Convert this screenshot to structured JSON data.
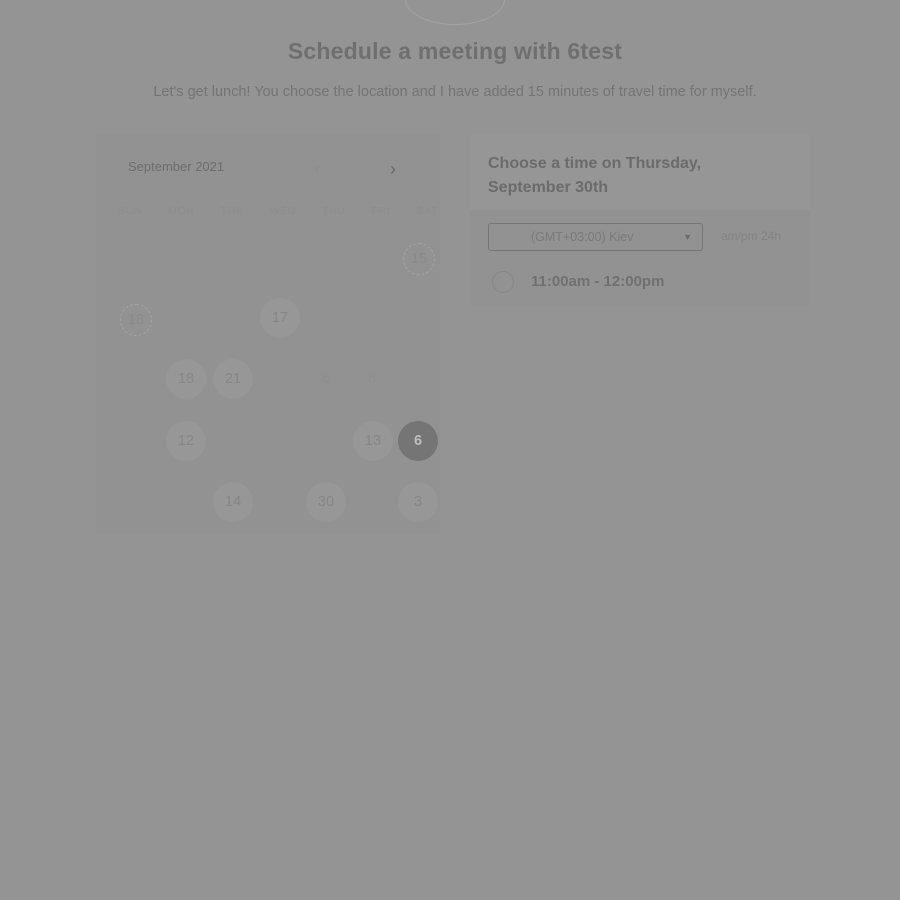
{
  "header": {
    "title": "Schedule a meeting with 6test",
    "subtitle": "Let's get lunch! You choose the location and I have added 15 minutes of travel time for myself."
  },
  "calendar": {
    "month_label": "September 2021",
    "prev_icon": "chevron-left-icon",
    "next_icon": "chevron-right-icon",
    "weekdays": [
      "SUN",
      "MON",
      "TUE",
      "WED",
      "THU",
      "FRI",
      "SAT"
    ],
    "days": [
      {
        "label": "15",
        "style": "dashed"
      },
      {
        "label": "18",
        "style": "dashed"
      },
      {
        "label": "17",
        "style": "available"
      },
      {
        "label": "18",
        "style": "available"
      },
      {
        "label": "21",
        "style": "available"
      },
      {
        "label": "6",
        "style": "faint"
      },
      {
        "label": "6",
        "style": "faint"
      },
      {
        "label": "12",
        "style": "available"
      },
      {
        "label": "13",
        "style": "available"
      },
      {
        "label": "6",
        "style": "selected"
      },
      {
        "label": "14",
        "style": "available"
      },
      {
        "label": "30",
        "style": "available"
      },
      {
        "label": "3",
        "style": "available"
      }
    ]
  },
  "time_panel": {
    "heading": "Choose a time on Thursday, September 30th",
    "timezone": "(GMT+03:00) Kiev",
    "timezone_caret_icon": "caret-down-icon",
    "format_toggle": "am/pm  24h",
    "slots": [
      {
        "label": "11:00am - 12:00pm"
      }
    ]
  }
}
